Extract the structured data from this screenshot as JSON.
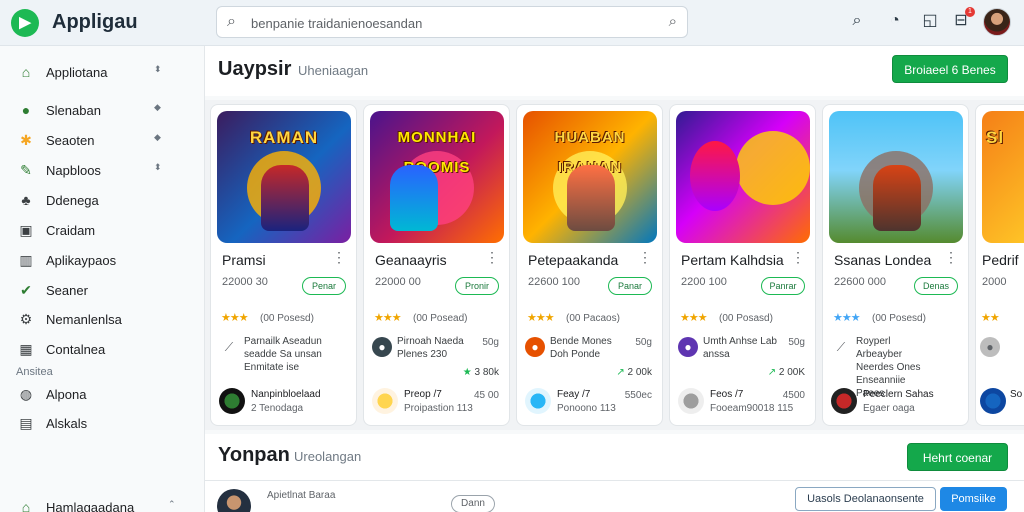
{
  "app": {
    "title": "Appligau",
    "logo_icon": "play-arrow-icon"
  },
  "search": {
    "value": "benpanie traidanienoesandan"
  },
  "topbar_icons": [
    "search-icon",
    "palette-icon",
    "bookmark-icon",
    "cart-icon"
  ],
  "notifications": {
    "count": "1"
  },
  "sidebar": {
    "items": [
      {
        "label": "Appliotana",
        "icon": "home-icon"
      },
      {
        "label": "Slenaban",
        "icon": "circle-icon"
      },
      {
        "label": "Seaoten",
        "icon": "puzzle-icon"
      },
      {
        "label": "Napbloos",
        "icon": "leaf-icon"
      },
      {
        "label": "Ddenega",
        "icon": "people-icon"
      },
      {
        "label": "Craidam",
        "icon": "book-icon"
      },
      {
        "label": "Aplikaypaos",
        "icon": "app-icon"
      },
      {
        "label": "Seaner",
        "icon": "check-icon"
      },
      {
        "label": "Nemanlenlsa",
        "icon": "settings-icon"
      },
      {
        "label": "Contalnea",
        "icon": "grid-icon"
      }
    ],
    "section_label": "Ansitea",
    "section_items": [
      {
        "label": "Alpona",
        "icon": "globe-icon"
      },
      {
        "label": "Alskals",
        "icon": "list-icon"
      }
    ],
    "bottom_item": {
      "label": "Hamlagaadana"
    }
  },
  "section1": {
    "title": "Uaypsir",
    "subtitle": "Uheniaagan",
    "button": "Broiaeel 6 Benes"
  },
  "section2": {
    "title": "Yonpan",
    "subtitle": "Ureolangan",
    "button": "Hehrt coenar"
  },
  "cards": [
    {
      "banner": "RAMAN",
      "title": "Pramsi",
      "size": "22000 30",
      "install": "Penar",
      "rating_count": "(00 Posesd)",
      "review": "Parnailk Aseadun seadde Sa unsan Enmitate ise",
      "review_meta": "",
      "downloads": "",
      "dev_name": "Nanpinbloelaad",
      "dev_sub": "2 Tenodaga",
      "dev_meta": ""
    },
    {
      "banner": "MONNHAI ROOMIS",
      "title": "Geanaayris",
      "size": "22000 00",
      "install": "Pronir",
      "rating_count": "(00 Posead)",
      "review": "Pirnoah Naeda Plenes 230",
      "review_meta": "50g",
      "downloads": "3 80k",
      "dev_name": "Preop /7",
      "dev_sub": "Proipastion 113",
      "dev_meta": "45 00"
    },
    {
      "banner": "HUABAN IRAHAN",
      "title": "Petepaakanda",
      "size": "22600 100",
      "install": "Panar",
      "rating_count": "(00 Pacaos)",
      "review": "Bende Mones Doh Ponde",
      "review_meta": "50g",
      "downloads": "2 00k",
      "dev_name": "Feay /7",
      "dev_sub": "Ponoono 113",
      "dev_meta": "550ec"
    },
    {
      "banner": "",
      "title": "Pertam Kalhdsia",
      "size": "2200 100",
      "install": "Panrar",
      "rating_count": "(00 Posasd)",
      "review": "Umth Anhse Lab anssa",
      "review_meta": "50g",
      "downloads": "2 00K",
      "dev_name": "Feos /7",
      "dev_sub": "Fooeam90018 115",
      "dev_meta": "4500"
    },
    {
      "banner": "",
      "title": "Ssanas Londea",
      "size": "22600 000",
      "install": "Denas",
      "rating_count": "(00 Posesd)",
      "review": "Royperl Arbeayber Neerdes Ones Enseanniie Paees",
      "review_meta": "",
      "downloads": "",
      "dev_name": "Peeclern Sahas",
      "dev_sub": "Egaer oaga",
      "dev_meta": ""
    },
    {
      "banner": "Sl",
      "title": "Pedrif",
      "size": "2000",
      "install": "",
      "rating_count": "",
      "review": "",
      "review_meta": "",
      "downloads": "",
      "dev_name": "So",
      "dev_sub": "",
      "dev_meta": ""
    }
  ],
  "bottom_row": {
    "title": "Apietlnat Baraa",
    "button": "Dann",
    "outline_button": "Uasols Deolanaonsente",
    "primary_button": "Pomsiike"
  },
  "colors": {
    "brand_green": "#1db954",
    "primary_button": "#14a84b",
    "blue_button": "#1e88e5",
    "star": "#f0a500"
  }
}
